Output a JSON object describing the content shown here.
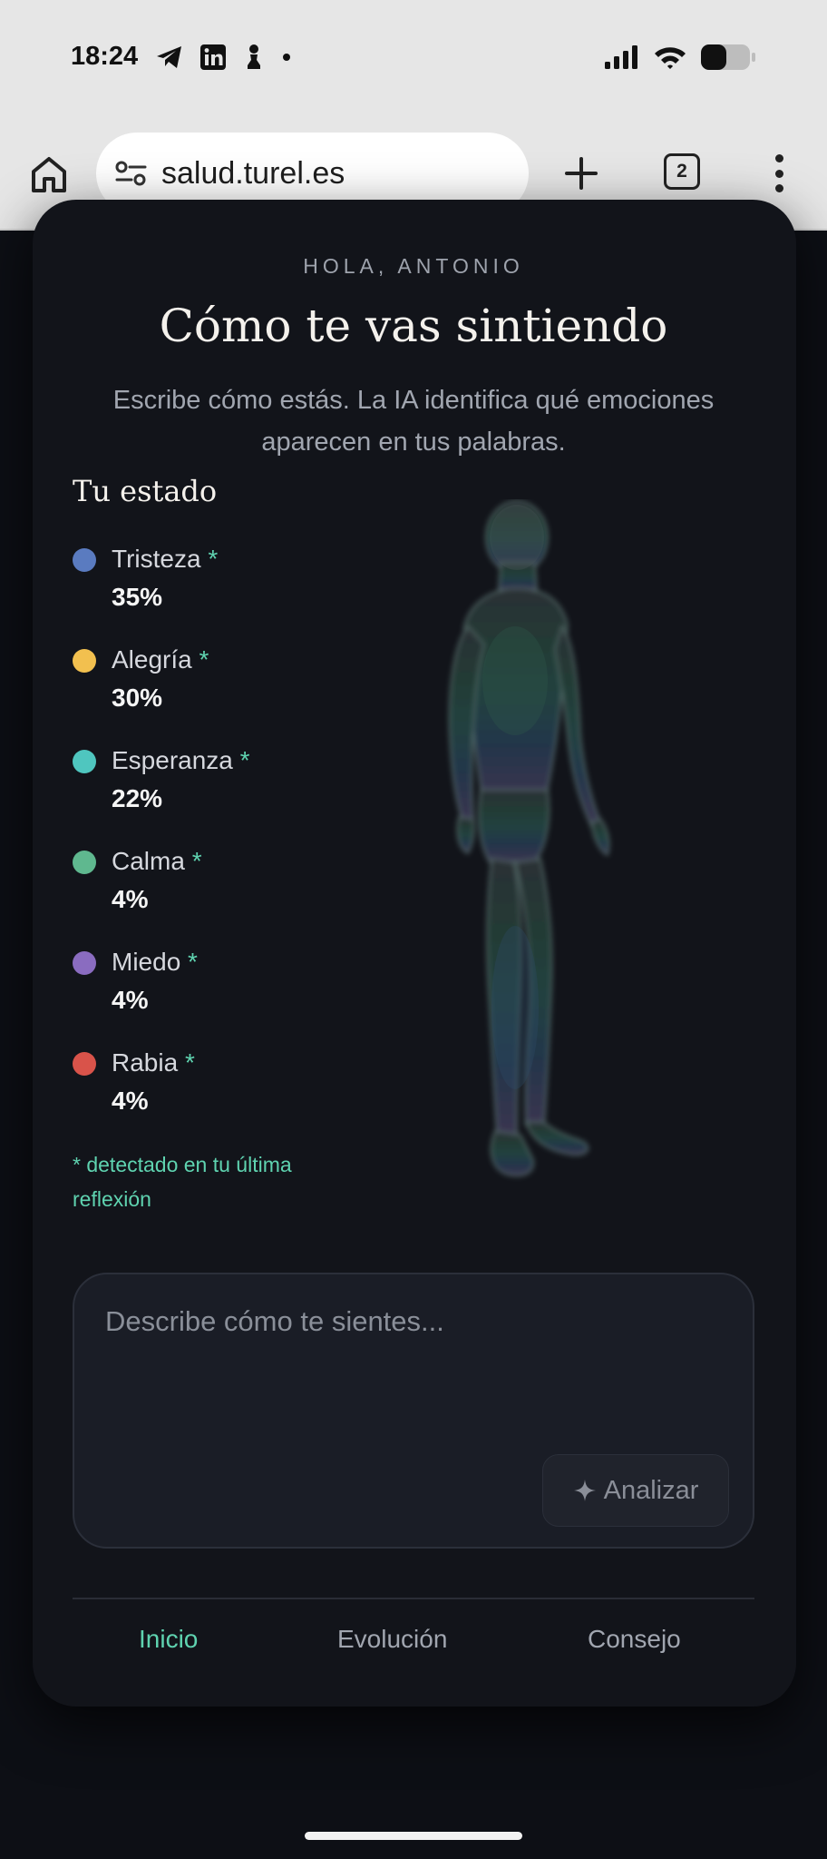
{
  "status_bar": {
    "time": "18:24",
    "left_icons": [
      "telegram-icon",
      "linkedin-icon",
      "chess-pawn-icon",
      "dot-icon"
    ],
    "right_icons": [
      "signal-icon",
      "wifi-icon",
      "battery-icon"
    ]
  },
  "browser": {
    "url": "salud.turel.es",
    "tab_count": "2"
  },
  "header": {
    "greeting": "HOLA, ANTONIO",
    "title": "Cómo te vas sintiendo",
    "subtitle": "Escribe cómo estás. La IA identifica qué emociones aparecen en tus palabras."
  },
  "estado": {
    "title": "Tu estado",
    "star": "*",
    "emotions": [
      {
        "name": "Tristeza",
        "pct": "35%",
        "color": "#5a7bc0"
      },
      {
        "name": "Alegría",
        "pct": "30%",
        "color": "#f2c04f"
      },
      {
        "name": "Esperanza",
        "pct": "22%",
        "color": "#4fc6bf"
      },
      {
        "name": "Calma",
        "pct": "4%",
        "color": "#5fb88f"
      },
      {
        "name": "Miedo",
        "pct": "4%",
        "color": "#8a6cc0"
      },
      {
        "name": "Rabia",
        "pct": "4%",
        "color": "#d9534a"
      }
    ],
    "footnote": "* detectado en tu última reflexión"
  },
  "input": {
    "placeholder": "Describe cómo te sientes...",
    "button_label": "Analizar"
  },
  "nav": {
    "items": [
      "Inicio",
      "Evolución",
      "Consejo"
    ],
    "active": "Inicio"
  },
  "colors": {
    "accent": "#5fd3b0",
    "card_bg": "#12141a",
    "page_bg": "#0d0f15"
  }
}
